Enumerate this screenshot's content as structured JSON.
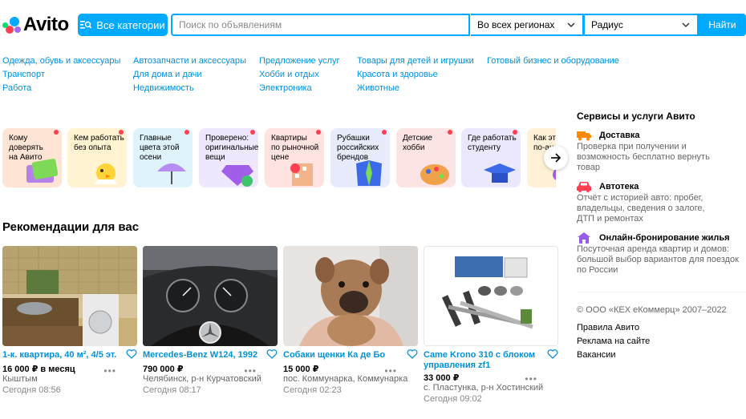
{
  "header": {
    "logo": "Avito",
    "categories_button": "Все категории",
    "search_placeholder": "Поиск по объявлениям",
    "region": "Во всех регионах",
    "radius": "Радиус",
    "find_button": "Найти"
  },
  "category_links": [
    [
      "Одежда, обувь и аксессуары",
      "Транспорт",
      "Работа"
    ],
    [
      "Автозапчасти и аксессуары",
      "Для дома и дачи",
      "Недвижимость"
    ],
    [
      "Предложение услуг",
      "Хобби и отдых",
      "Электроника"
    ],
    [
      "Товары для детей и игрушки",
      "Красота и здоровье",
      "Животные"
    ],
    [
      "Готовый бизнес и оборудование"
    ]
  ],
  "stories": [
    {
      "lines": [
        "Кому",
        "доверять",
        "на Авито"
      ],
      "bg": "#fde4d5",
      "new": true
    },
    {
      "lines": [
        "Кем работать",
        "без опыта"
      ],
      "bg": "#fff3d1",
      "new": true
    },
    {
      "lines": [
        "Главные",
        "цвета этой",
        "осени"
      ],
      "bg": "#def3fb",
      "new": true
    },
    {
      "lines": [
        "Проверено:",
        "оригинальные",
        "вещи"
      ],
      "bg": "#efe7fd",
      "new": true
    },
    {
      "lines": [
        "Квартиры",
        "по рыночной",
        "цене"
      ],
      "bg": "#ffe3e0",
      "new": true
    },
    {
      "lines": [
        "Рубашки",
        "российских",
        "брендов"
      ],
      "bg": "#e7ebfb",
      "new": true
    },
    {
      "lines": [
        "Детские",
        "хобби"
      ],
      "bg": "#fde4e4",
      "new": true
    },
    {
      "lines": [
        "Где работать",
        "студенту"
      ],
      "bg": "#ebe7fd",
      "new": true
    },
    {
      "lines": [
        "Как эт",
        "по-ан"
      ],
      "bg": "#fff1d6",
      "new": false
    }
  ],
  "recommendations": {
    "title": "Рекомендации для вас",
    "items": [
      {
        "title": "1-к. квартира, 40 м², 4/5 эт.",
        "price": "16 000 ₽ в месяц",
        "location": "Кыштым",
        "date": "Сегодня 08:56"
      },
      {
        "title": "Mercedes-Benz W124, 1992",
        "price": "790 000 ₽",
        "location": "Челябинск, р-н Курчатовский",
        "date": "Сегодня 08:17"
      },
      {
        "title": "Собаки щенки Ка де Бо",
        "price": "15 000 ₽",
        "location": "пос. Коммунарка, Коммунарка",
        "date": "Сегодня 02:23"
      },
      {
        "title": "Came Krono 310 с блоком управления zf1",
        "price": "33 000 ₽",
        "location": "с. Пластунка, р-н Хостинский",
        "date": "Сегодня 09:02"
      }
    ]
  },
  "sidebar": {
    "title": "Сервисы и услуги Авито",
    "services": [
      {
        "name": "Доставка",
        "desc": "Проверка при получении и возможность бесплатно вернуть товар",
        "icon": "truck-icon",
        "color": "#ff8a00"
      },
      {
        "name": "Автотека",
        "desc": "Отчёт с историей авто: пробег, владельцы, сведения о залоге, ДТП и ремонтах",
        "icon": "car-icon",
        "color": "#ff4053"
      },
      {
        "name": "Онлайн-бронирование жилья",
        "desc": "Посуточная аренда квартир и домов: большой выбор вариантов для поездок по России",
        "icon": "house-icon",
        "color": "#965eeb"
      }
    ],
    "copyright": "© ООО «КЕХ еКоммерц» 2007–2022",
    "links": [
      "Правила Авито",
      "Реклама на сайте",
      "Вакансии"
    ]
  }
}
